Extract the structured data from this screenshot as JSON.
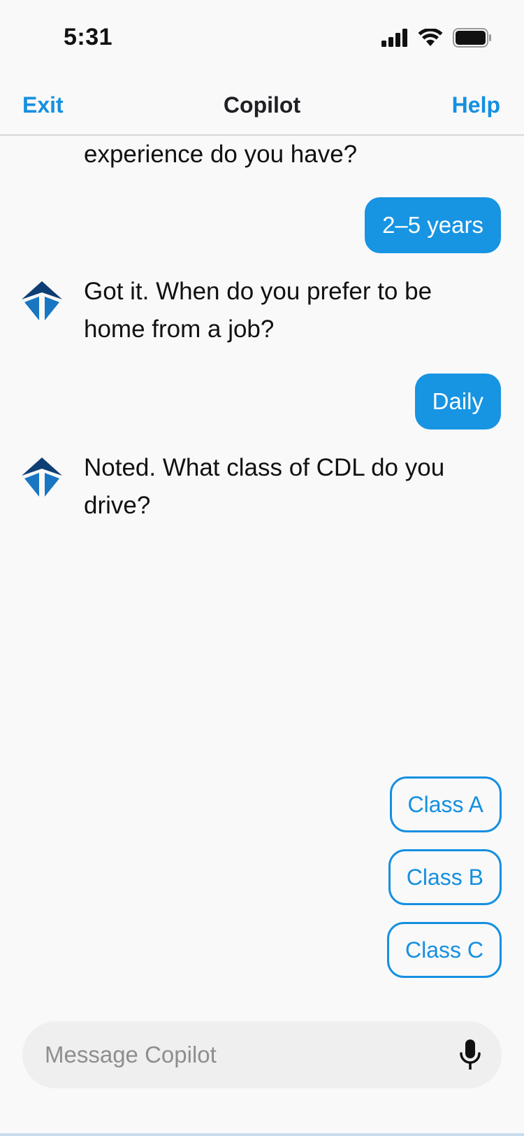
{
  "status": {
    "time": "5:31"
  },
  "nav": {
    "exit_label": "Exit",
    "title": "Copilot",
    "help_label": "Help",
    "accent_color": "#1590e0"
  },
  "messages": [
    {
      "role": "bot",
      "text": "experience do you have?"
    },
    {
      "role": "user",
      "text": "2–5 years"
    },
    {
      "role": "bot",
      "text": "Got it. When do you prefer to be home from a job?"
    },
    {
      "role": "user",
      "text": "Daily"
    },
    {
      "role": "bot",
      "text": "Noted. What class of CDL do you drive?"
    }
  ],
  "quick_replies": [
    "Class A",
    "Class B",
    "Class C"
  ],
  "composer": {
    "placeholder": "Message Copilot",
    "value": "",
    "mic_icon": "microphone-icon"
  },
  "icons": {
    "signal": "cellular-signal-icon",
    "wifi": "wifi-icon",
    "battery": "battery-icon",
    "bot": "copilot-logo-icon"
  },
  "colors": {
    "user_bubble": "#1794e2",
    "logo_dark": "#0e3e73",
    "logo_light": "#1976c2",
    "background": "#f9f9fa"
  }
}
